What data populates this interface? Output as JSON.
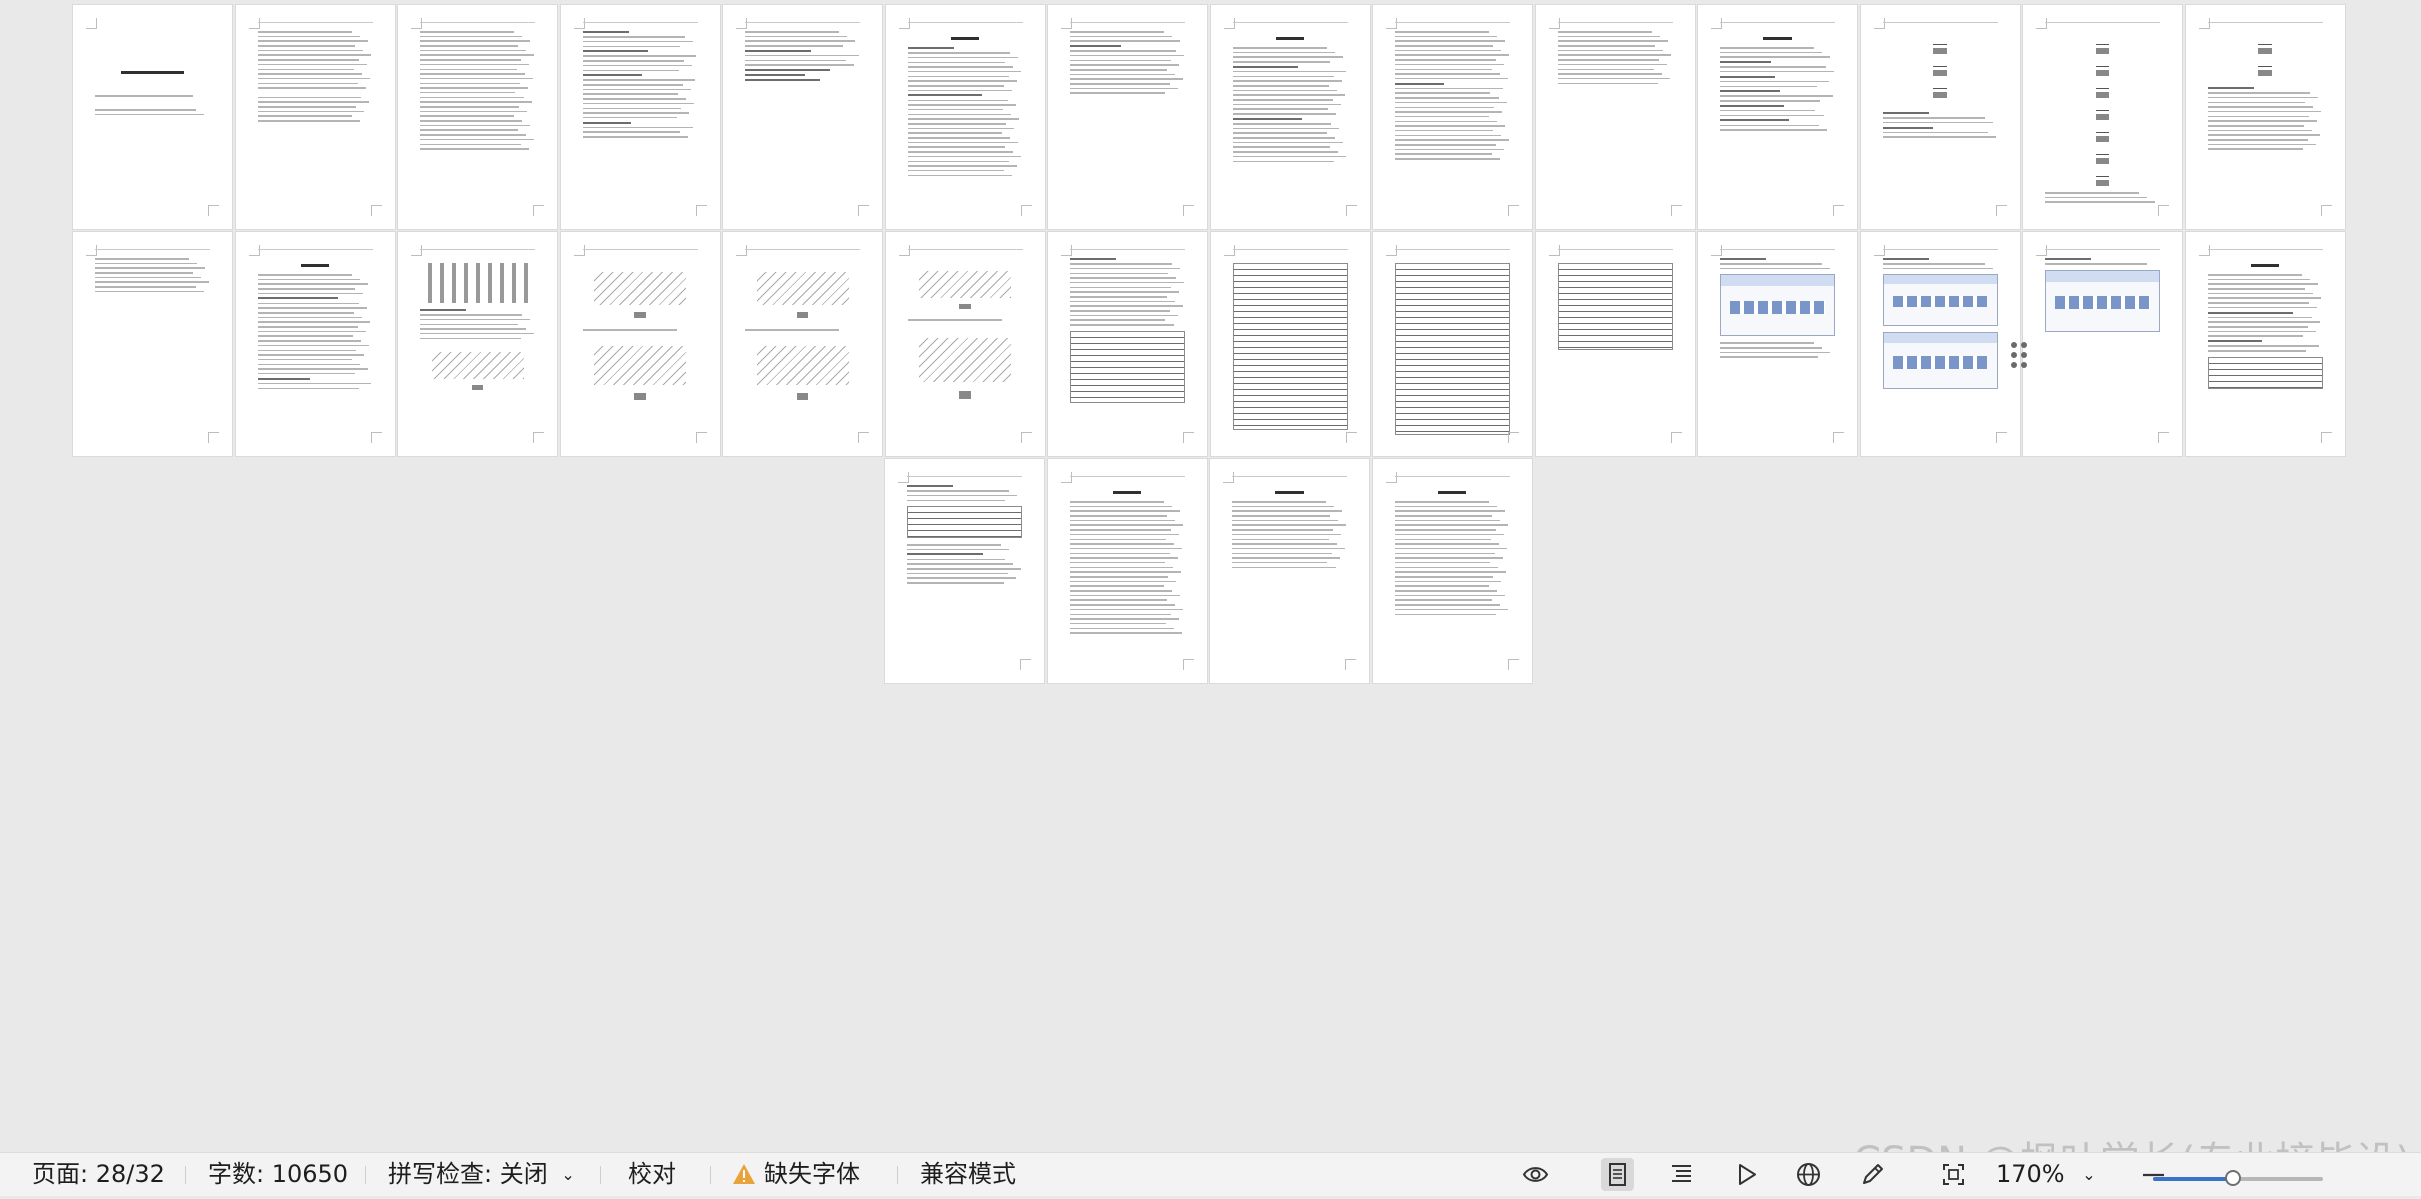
{
  "document": {
    "page_count": 32,
    "current_page": 28,
    "pages": [
      {
        "lines": [
          0,
          0,
          0,
          1,
          0,
          0,
          1,
          1
        ],
        "title": true,
        "cover": true
      },
      {
        "lines": [
          1,
          1,
          1,
          1,
          1,
          1,
          1,
          1,
          1,
          1,
          1,
          1,
          1,
          0,
          1,
          1,
          1,
          1,
          1,
          1
        ]
      },
      {
        "lines": [
          1,
          1,
          1,
          1,
          1,
          1,
          1,
          1,
          1,
          1,
          1,
          1,
          1,
          1,
          1,
          1,
          1,
          1,
          1,
          1,
          1,
          1,
          1,
          1,
          1,
          1
        ]
      },
      {
        "toc": true,
        "lines": [
          2,
          1,
          1,
          1,
          2,
          1,
          1,
          1,
          1,
          2,
          1,
          1,
          1,
          1,
          1,
          1,
          1,
          1,
          1,
          2,
          1,
          1,
          1
        ]
      },
      {
        "toc": true,
        "lines": [
          1,
          1,
          1,
          1,
          2,
          1,
          1,
          1,
          2,
          2,
          2
        ]
      },
      {
        "title": true,
        "lines": [
          2,
          1,
          1,
          1,
          1,
          1,
          1,
          1,
          1,
          1,
          2,
          1,
          1,
          1,
          1,
          1,
          1,
          1,
          1,
          1,
          1,
          1,
          1,
          1,
          1,
          1,
          1,
          1
        ]
      },
      {
        "lines": [
          1,
          1,
          1,
          2,
          1,
          1,
          1,
          1,
          1,
          1,
          1,
          1,
          1,
          1
        ]
      },
      {
        "title": true,
        "lines": [
          1,
          1,
          1,
          1,
          2,
          1,
          1,
          1,
          1,
          1,
          1,
          1,
          1,
          1,
          1,
          2,
          1,
          1,
          1,
          1,
          1,
          1,
          1,
          1,
          1
        ]
      },
      {
        "lines": [
          1,
          1,
          1,
          1,
          1,
          1,
          1,
          1,
          1,
          1,
          1,
          2,
          1,
          1,
          1,
          1,
          1,
          1,
          1,
          1,
          1,
          1,
          1,
          1,
          1,
          1,
          1,
          1
        ]
      },
      {
        "lines": [
          1,
          1,
          1,
          1,
          1,
          1,
          1,
          1,
          1,
          1,
          1,
          1
        ]
      },
      {
        "title": true,
        "lines": [
          1,
          1,
          1,
          2,
          1,
          1,
          2,
          1,
          1,
          2,
          1,
          1,
          2,
          1,
          1,
          2,
          1,
          1
        ]
      },
      {
        "lines": [
          2,
          1,
          1,
          2,
          1,
          1
        ],
        "block": "flow",
        "bh": 70
      },
      {
        "block": "flow",
        "bh": 150,
        "lines": [
          1,
          1,
          1
        ]
      },
      {
        "block": "flow",
        "bh": 45,
        "lines": [
          2,
          1,
          1,
          1,
          1,
          1,
          1,
          1,
          1,
          1,
          1,
          1,
          1,
          1
        ]
      },
      {
        "lines": [
          1,
          1,
          1,
          1,
          1,
          1,
          1,
          1
        ]
      },
      {
        "title": true,
        "lines": [
          1,
          1,
          1,
          1,
          1,
          2,
          1,
          1,
          1,
          1,
          1,
          1,
          1,
          1,
          1,
          1,
          1,
          1,
          1,
          1,
          1,
          1,
          2,
          1,
          1
        ]
      },
      {
        "block": "bars",
        "bh": 40,
        "lines": [
          2,
          1,
          1,
          1,
          1,
          1,
          1
        ],
        "block2": "tree",
        "bh2": 50
      },
      {
        "block": "tree",
        "bh": 60,
        "lines": [
          1
        ],
        "block2": "tree",
        "bh2": 70
      },
      {
        "block": "tree",
        "bh": 60,
        "lines": [
          1
        ],
        "block2": "tree",
        "bh2": 70
      },
      {
        "block": "tree",
        "bh": 50,
        "lines": [
          1
        ],
        "block2": "tree",
        "bh2": 80
      },
      {
        "lines": [
          2,
          1,
          1,
          1,
          1,
          1,
          1,
          1,
          1,
          1,
          1,
          1,
          1,
          1,
          1
        ],
        "block": "tbl",
        "bh": 70
      },
      {
        "block": "tbl",
        "bh": 165
      },
      {
        "block": "tbl",
        "bh": 170
      },
      {
        "block": "tbl",
        "bh": 85
      },
      {
        "lines": [
          2,
          1,
          1
        ],
        "block": "scr",
        "bh": 60,
        "lines2": [
          1,
          1,
          1,
          1
        ]
      },
      {
        "block": "scr",
        "bh": 50,
        "lines": [
          2,
          1,
          1
        ],
        "block2": "scr",
        "bh2": 55
      },
      {
        "lines": [
          2,
          1
        ],
        "block": "scr",
        "bh": 60
      },
      {
        "title": true,
        "lines": [
          1,
          1,
          1,
          1,
          1,
          1,
          1,
          1,
          2,
          1,
          1,
          1,
          1,
          1,
          2,
          1,
          1
        ],
        "block": "tbl",
        "bh": 30
      },
      {
        "lines": [
          2,
          1,
          1,
          1
        ],
        "block": "tbl",
        "bh": 30,
        "lines2": [
          1,
          1,
          2,
          1,
          1,
          1,
          1,
          1,
          1
        ]
      },
      {
        "title": true,
        "lines": [
          1,
          1,
          1,
          1,
          1,
          1,
          1,
          1,
          1,
          1,
          1,
          1,
          1,
          1,
          1,
          1,
          1,
          1,
          1,
          1,
          1,
          1,
          1,
          1,
          1,
          1,
          1,
          1,
          1
        ]
      },
      {
        "title": true,
        "lines": [
          1,
          1,
          1,
          1,
          1,
          1,
          1,
          1,
          1,
          1,
          1,
          1,
          1,
          1,
          1
        ]
      },
      {
        "title": true,
        "lines": [
          1,
          1,
          1,
          1,
          1,
          1,
          1,
          1,
          1,
          1,
          1,
          1,
          1,
          1,
          1,
          1,
          1,
          1,
          1,
          1,
          1,
          1,
          1,
          1,
          1
        ]
      }
    ]
  },
  "statusbar": {
    "page_label": "页面: 28/32",
    "word_count": "字数: 10650",
    "spell_check": "拼写检查: 关闭",
    "proofread": "校对",
    "missing_fonts": "缺失字体",
    "compat_mode": "兼容模式",
    "zoom": "170%",
    "zoom_fraction": 0.47
  },
  "watermark": "CSDN @枫叶学长(专业接毕设)",
  "colors": {
    "warning": "#e8a33a",
    "zoom_accent": "#3a73c9"
  },
  "icons": [
    "eye-icon",
    "page-view-icon",
    "outline-icon",
    "play-icon",
    "globe-icon",
    "pen-icon",
    "fit-window-icon",
    "chevron-down-icon",
    "zoom-out-icon",
    "warning-icon"
  ]
}
